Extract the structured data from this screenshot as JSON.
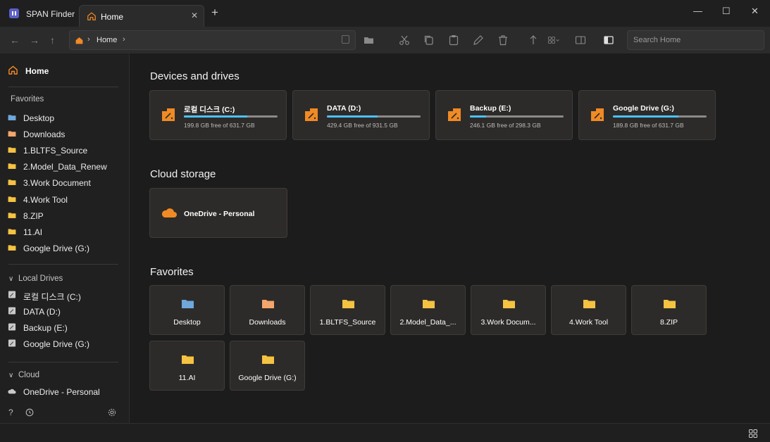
{
  "app": {
    "title": "SPAN Finder",
    "accent": "#f08a24"
  },
  "tabs": [
    {
      "label": "Home",
      "icon": "home-icon"
    }
  ],
  "window_controls": {
    "minimize": "—",
    "maximize": "☐",
    "close": "✕"
  },
  "toolbar": {
    "address": "Home",
    "search_placeholder": "Search Home"
  },
  "sidebar": {
    "home_label": "Home",
    "favorites_title": "Favorites",
    "favorites": [
      {
        "label": "Desktop",
        "color": "#6fa8dc"
      },
      {
        "label": "Downloads",
        "color": "#f4a66c"
      },
      {
        "label": "1.BLTFS_Source",
        "color": "#f5c242"
      },
      {
        "label": "2.Model_Data_Renew",
        "color": "#f5c242"
      },
      {
        "label": "3.Work Document",
        "color": "#f5c242"
      },
      {
        "label": "4.Work Tool",
        "color": "#f5c242"
      },
      {
        "label": "8.ZIP",
        "color": "#f5c242"
      },
      {
        "label": "11.AI",
        "color": "#f5c242"
      },
      {
        "label": "Google Drive (G:)",
        "color": "#f5c242"
      }
    ],
    "local_title": "Local Drives",
    "local_drives": [
      {
        "label": "로컬 디스크 (C:)"
      },
      {
        "label": "DATA (D:)"
      },
      {
        "label": "Backup (E:)"
      },
      {
        "label": "Google Drive (G:)"
      }
    ],
    "cloud_title": "Cloud",
    "cloud_items": [
      {
        "label": "OneDrive - Personal"
      }
    ]
  },
  "main": {
    "devices_title": "Devices and drives",
    "drives": [
      {
        "name": "로컬 디스크 (C:)",
        "free": "199.8 GB free of 631.7 GB",
        "used_fraction": 0.68
      },
      {
        "name": "DATA (D:)",
        "free": "429.4 GB free of 931.5 GB",
        "used_fraction": 0.54
      },
      {
        "name": "Backup (E:)",
        "free": "246.1 GB free of 298.3 GB",
        "used_fraction": 0.17
      },
      {
        "name": "Google Drive (G:)",
        "free": "189.8 GB free of 631.7 GB",
        "used_fraction": 0.7
      }
    ],
    "cloud_title": "Cloud storage",
    "cloud": {
      "label": "OneDrive - Personal"
    },
    "favorites_title": "Favorites",
    "favorites": [
      {
        "label": "Desktop",
        "color": "#6fa8dc"
      },
      {
        "label": "Downloads",
        "color": "#f4a66c"
      },
      {
        "label": "1.BLTFS_Source",
        "color": "#f5c242"
      },
      {
        "label": "2.Model_Data_...",
        "color": "#f5c242"
      },
      {
        "label": "3.Work Docum...",
        "color": "#f5c242"
      },
      {
        "label": "4.Work Tool",
        "color": "#f5c242"
      },
      {
        "label": "8.ZIP",
        "color": "#f5c242"
      },
      {
        "label": "11.AI",
        "color": "#f5c242"
      },
      {
        "label": "Google Drive (G:)",
        "color": "#f5c242"
      }
    ]
  }
}
